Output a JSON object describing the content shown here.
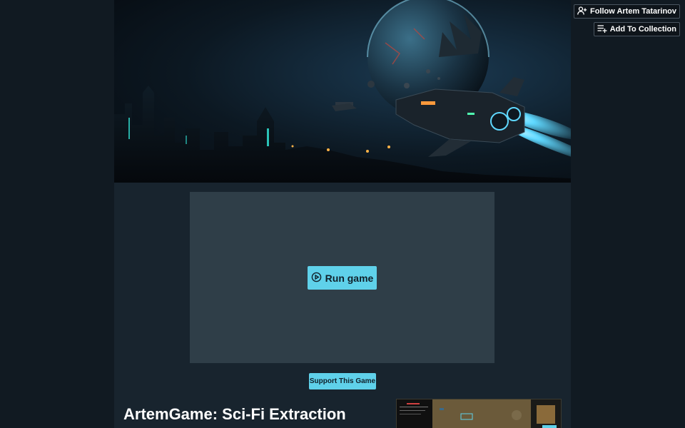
{
  "header": {
    "follow_label": "Follow Artem Tatarinov",
    "collection_label": "Add To Collection"
  },
  "game": {
    "run_label": "Run game",
    "support_label": "Support This Game",
    "title": "ArtemGame: Sci-Fi Extraction"
  },
  "colors": {
    "page_bg": "#111a22",
    "column_bg": "#18242e",
    "frame_bg": "#2f3e48",
    "accent": "#5fd1ea"
  },
  "icons": {
    "follow": "user-plus-icon",
    "collection": "playlist-add-icon",
    "run": "play-circle-icon"
  }
}
